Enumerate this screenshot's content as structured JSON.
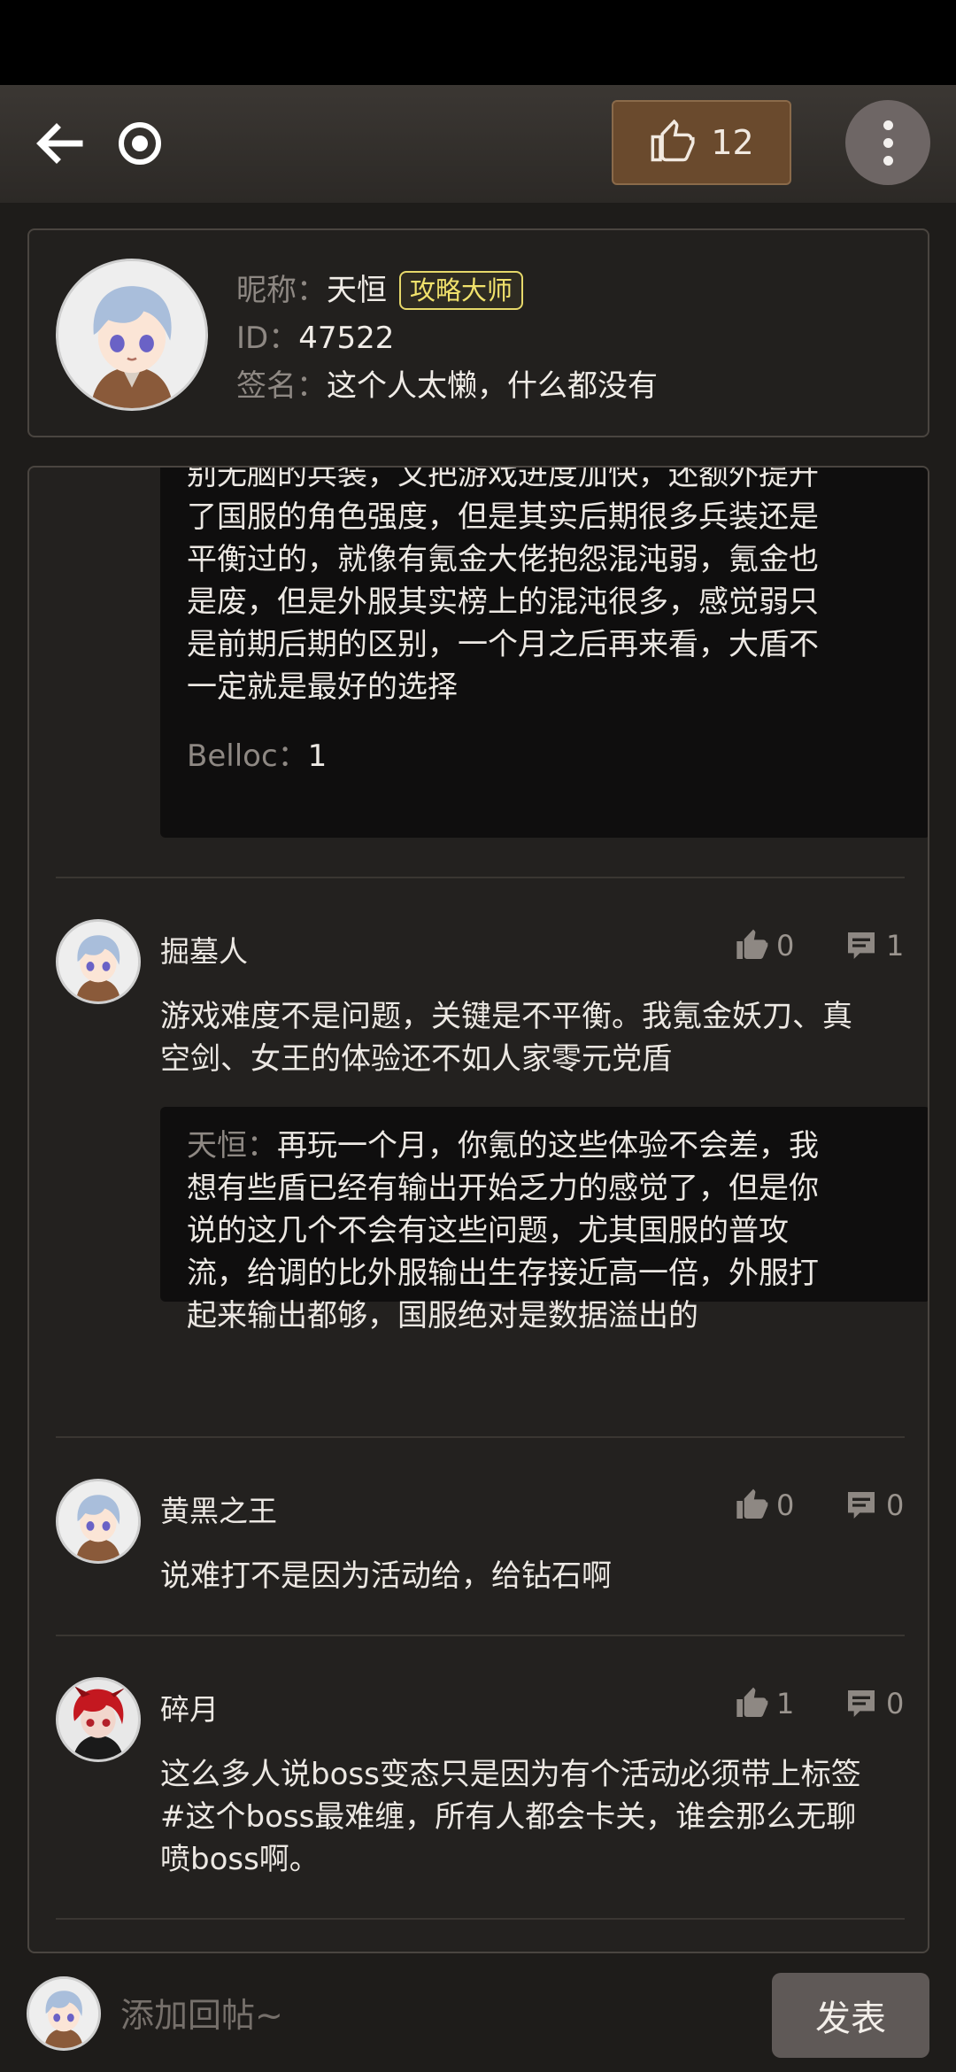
{
  "topbar": {
    "like_count": "12"
  },
  "profile": {
    "nickname_label": "昵称：",
    "nickname": "天恒",
    "badge": "攻略大师",
    "id_label": "ID：",
    "id": "47522",
    "signature_label": "签名：",
    "signature": "这个人太懒，什么都没有"
  },
  "top_reply": {
    "lines": [
      "别无脑的兵装，又把游戏进度加快，还额外提升",
      "了国服的角色强度，但是其实后期很多兵装还是",
      "平衡过的，就像有氪金大佬抱怨混沌弱，氪金也",
      "是废，但是外服其实榜上的混沌很多，感觉弱只",
      "是前期后期的区别，一个月之后再来看，大盾不",
      "一定就是最好的选择"
    ],
    "sub_name": "Belloc：",
    "sub_text": "1"
  },
  "comments": [
    {
      "name": "掘墓人",
      "likes": "0",
      "replies": "1",
      "lines": [
        "游戏难度不是问题，关键是不平衡。我氪金妖刀、真",
        "空剑、女王的体验还不如人家零元党盾"
      ],
      "reply": {
        "name": "天恒：",
        "first": "再玩一个月，你氪的这些体验不会差，我",
        "lines": [
          "想有些盾已经有输出开始乏力的感觉了，但是你",
          "说的这几个不会有这些问题，尤其国服的普攻",
          "流，给调的比外服输出生存接近高一倍，外服打",
          "起来输出都够，国服绝对是数据溢出的"
        ]
      }
    },
    {
      "name": "黄黑之王",
      "likes": "0",
      "replies": "0",
      "lines": [
        "说难打不是因为活动给，给钻石啊"
      ]
    },
    {
      "name": "碎月",
      "likes": "1",
      "replies": "0",
      "lines": [
        "这么多人说boss变态只是因为有个活动必须带上标签",
        "#这个boss最难缠，所有人都会卡关，谁会那么无聊",
        "喷boss啊。"
      ]
    }
  ],
  "bottom": {
    "placeholder": "添加回帖~",
    "send_label": "发表"
  },
  "colors": {
    "background": "#1e1c1a",
    "like_button": "#6a4a2d",
    "badge": "#e6d86a",
    "send_button": "#5f5957"
  },
  "icons": [
    "back-arrow-icon",
    "target-icon",
    "thumbs-up-icon",
    "more-vertical-icon",
    "comment-icon"
  ]
}
